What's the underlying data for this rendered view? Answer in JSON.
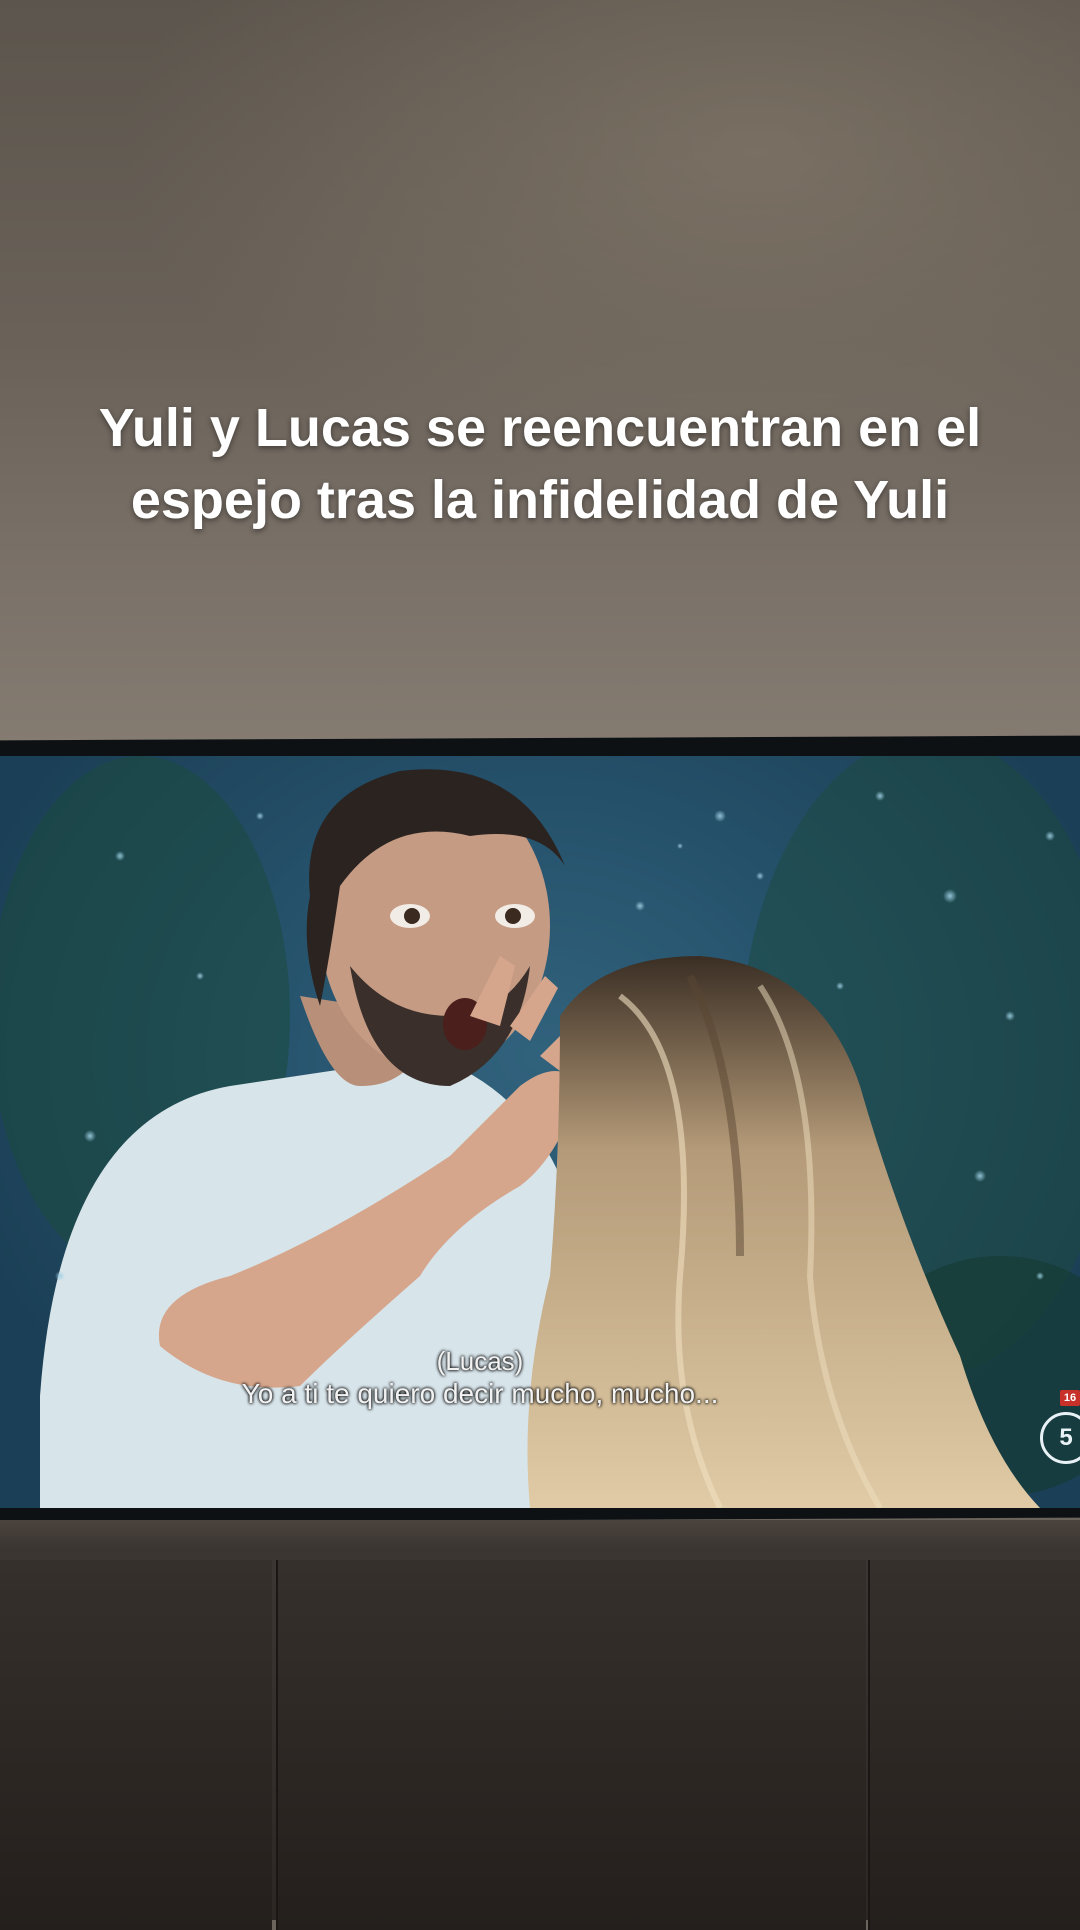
{
  "overlay": {
    "caption_line1": "Yuli y Lucas se reencuentran en el",
    "caption_line2": "espejo tras la infidelidad de Yuli"
  },
  "tv_screen": {
    "subtitle_speaker": "(Lucas)",
    "subtitle_text": "Yo a ti te quiero decir mucho, mucho...",
    "age_rating_badge": "16",
    "channel_logo": "5"
  },
  "colors": {
    "wall": "#6b645c",
    "screen_accent": "#2a5670",
    "cabinet": "#2c2724",
    "rating_badge": "#c8302a"
  }
}
